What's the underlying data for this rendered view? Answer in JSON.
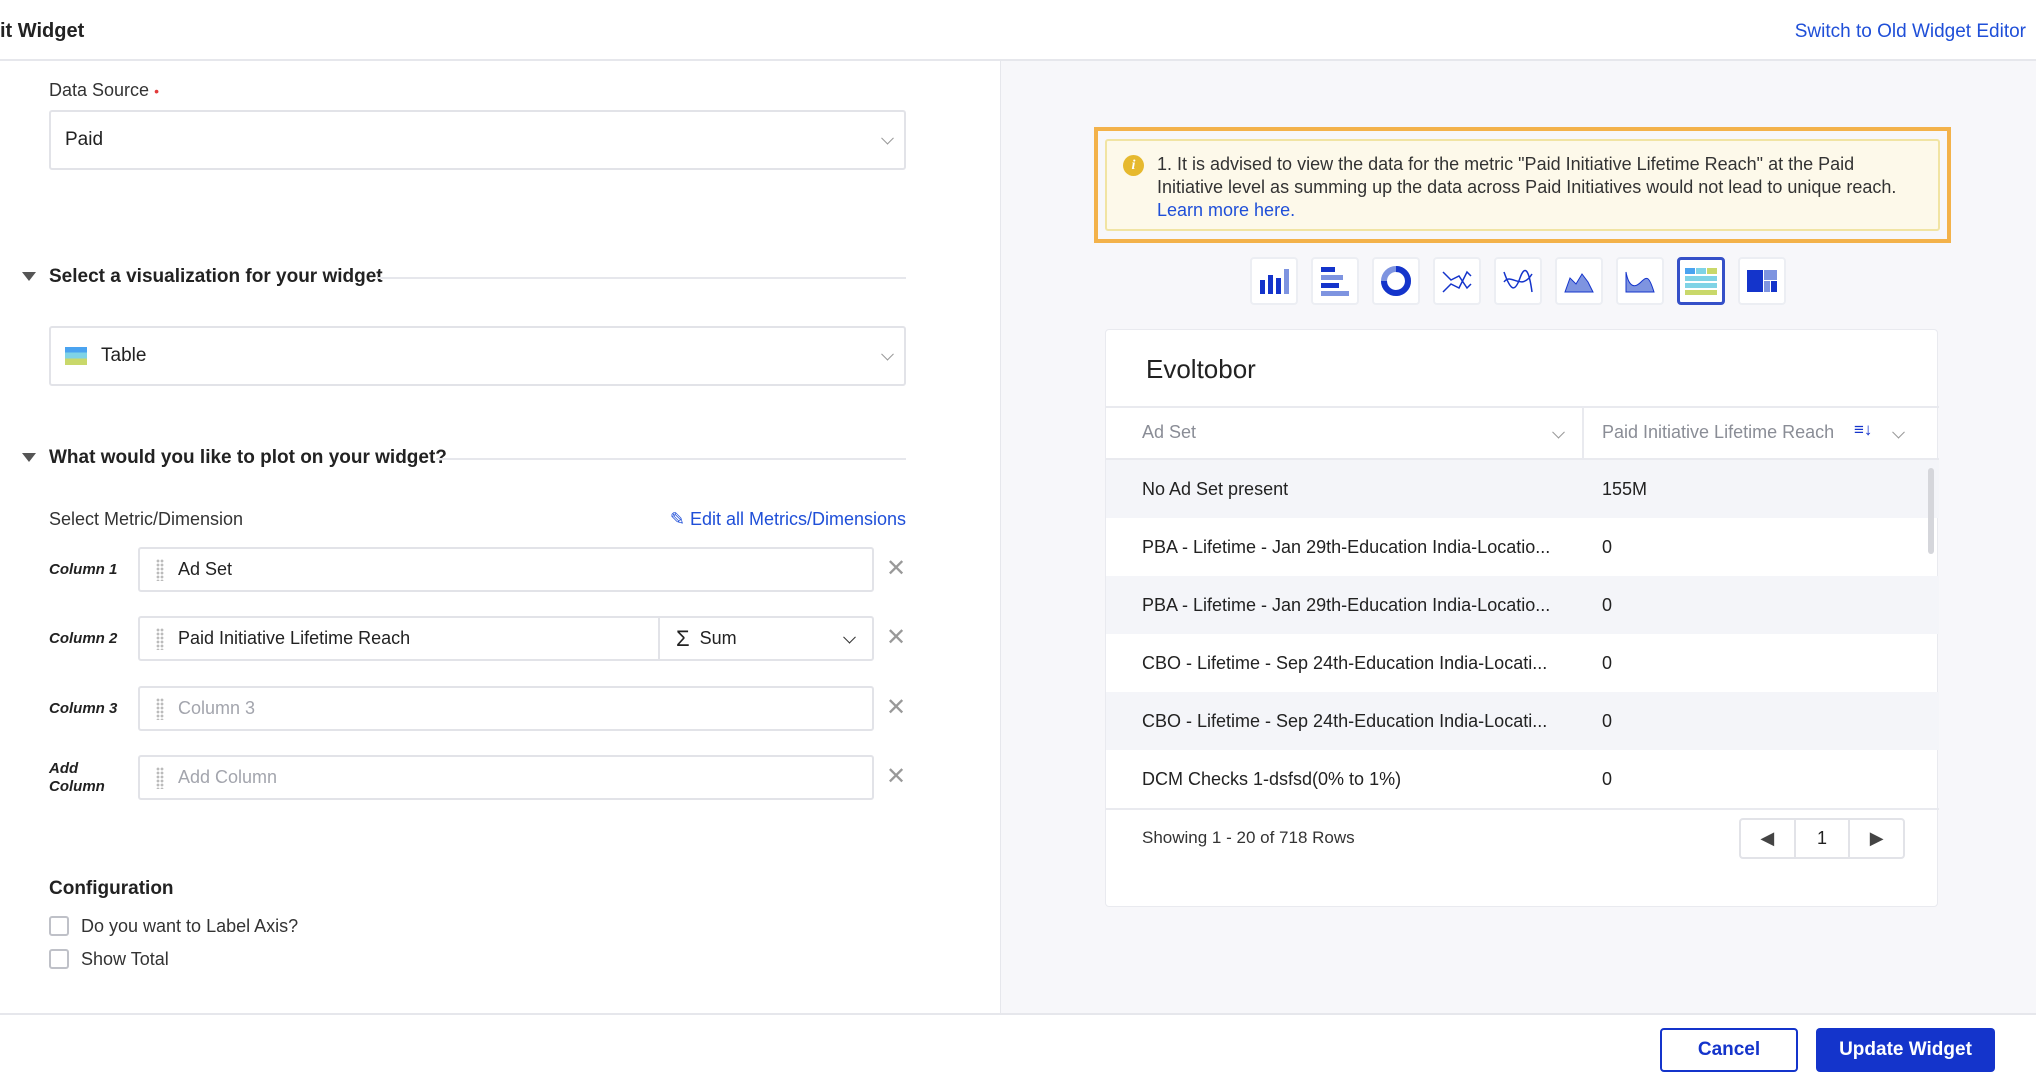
{
  "header": {
    "title": "it Widget",
    "switch_link": "Switch to Old Widget Editor"
  },
  "form": {
    "data_source": {
      "label": "Data Source",
      "required_marker": "•",
      "value": "Paid"
    },
    "visualization": {
      "section_title": "Select a visualization for your widget",
      "value": "Table",
      "icon": "table-icon"
    },
    "plot": {
      "section_title": "What would you like to plot on your widget?",
      "select_label": "Select Metric/Dimension",
      "edit_link": "Edit all Metrics/Dimensions",
      "columns": [
        {
          "label": "Column 1",
          "value": "Ad Set",
          "placeholder": ""
        },
        {
          "label": "Column 2",
          "value": "Paid Initiative Lifetime Reach",
          "aggregation": "Sum",
          "aggregation_symbol": "Σ"
        },
        {
          "label": "Column 3",
          "value": "",
          "placeholder": "Column 3"
        },
        {
          "label": "Add Column",
          "value": "",
          "placeholder": "Add Column"
        }
      ]
    },
    "configuration": {
      "title": "Configuration",
      "options": [
        {
          "label": "Do you want to Label Axis?",
          "checked": false
        },
        {
          "label": "Show Total",
          "checked": false
        }
      ]
    }
  },
  "preview": {
    "warning": {
      "text": "1. It is advised to view the data for the metric \"Paid Initiative Lifetime Reach\" at the Paid Initiative level as summing up the data across Paid Initiatives would not lead to unique reach.",
      "link": "Learn more here."
    },
    "chart_types": [
      {
        "name": "column-chart",
        "selected": false
      },
      {
        "name": "bar-chart",
        "selected": false
      },
      {
        "name": "donut-chart",
        "selected": false
      },
      {
        "name": "line-chart",
        "selected": false
      },
      {
        "name": "spline-chart",
        "selected": false
      },
      {
        "name": "area-chart",
        "selected": false
      },
      {
        "name": "spline-area-chart",
        "selected": false
      },
      {
        "name": "table",
        "selected": true
      },
      {
        "name": "treemap",
        "selected": false
      }
    ],
    "widget": {
      "title": "Evoltobor",
      "columns": [
        "Ad Set",
        "Paid Initiative Lifetime Reach"
      ],
      "rows": [
        [
          "No Ad Set present",
          "155M"
        ],
        [
          "PBA - Lifetime - Jan 29th-Education India-Locatio...",
          "0"
        ],
        [
          "PBA - Lifetime - Jan 29th-Education India-Locatio...",
          "0"
        ],
        [
          "CBO - Lifetime - Sep 24th-Education India-Locati...",
          "0"
        ],
        [
          "CBO - Lifetime - Sep 24th-Education India-Locati...",
          "0"
        ],
        [
          "DCM Checks 1-dsfsd(0% to 1%)",
          "0"
        ]
      ],
      "showing": "Showing 1 - 20 of 718 Rows",
      "page": "1"
    }
  },
  "footer": {
    "cancel": "Cancel",
    "update": "Update Widget"
  },
  "colors": {
    "primary": "#1434cb",
    "link": "#1f4fd8",
    "warning_border": "#f3b24a",
    "warning_bg": "#fdf9ea"
  }
}
